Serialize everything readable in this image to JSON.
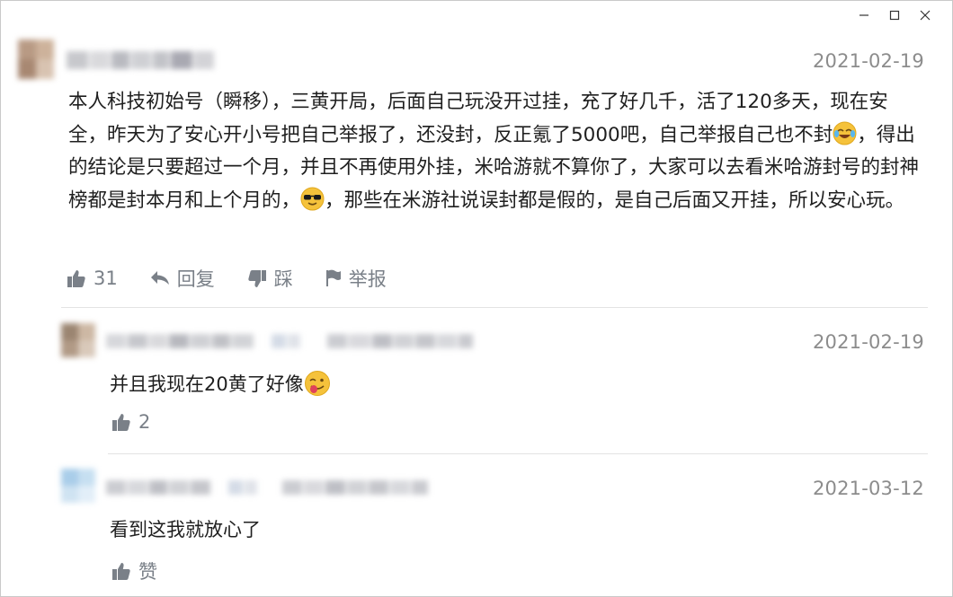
{
  "window": {
    "controls": [
      "minimize-icon",
      "maximize-icon",
      "close-icon"
    ]
  },
  "comment": {
    "date": "2021-02-19",
    "text": {
      "part1": "本人科技初始号（瞬移），三黄开局，后面自己玩没开过挂，充了好几千，活了120多天，现在安全，昨天为了安心开小号把自己举报了，还没封，反正氪了5000吧，自己举报自己也不封",
      "part2": "，得出的结论是只要超过一个月，并且不再使用外挂，米哈游就不算你了，大家可以去看米哈游封号的封神榜都是封本月和上个月的，",
      "part3": "，那些在米游社说误封都是假的，是自己后面又开挂，所以安心玩。"
    },
    "emojis": [
      "crying-laugh-emoji",
      "sunglasses-emoji"
    ],
    "actions": {
      "like_count": "31",
      "reply_label": "回复",
      "dislike_label": "踩",
      "report_label": "举报"
    }
  },
  "replies": [
    {
      "date": "2021-02-19",
      "text": "并且我现在20黄了好像",
      "emoji": "winking-tongue-emoji",
      "like_label": "2"
    },
    {
      "date": "2021-03-12",
      "text": "看到这我就放心了",
      "like_label": "赞"
    }
  ],
  "colors": {
    "text": "#1f1f1f",
    "muted": "#8c8c8c",
    "icon": "#7a8088",
    "divider": "#e3e3e3"
  }
}
